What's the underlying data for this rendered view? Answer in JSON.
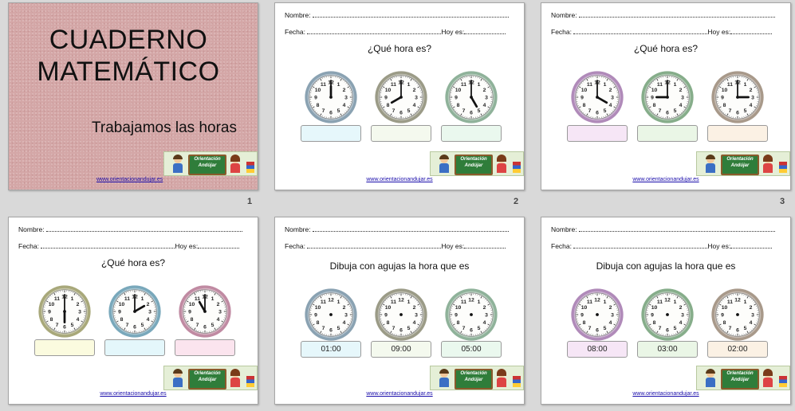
{
  "slide_numbers": [
    "1",
    "2",
    "3",
    "",
    "",
    ""
  ],
  "cover": {
    "title_line1": "CUADERNO",
    "title_line2": "MATEMÁTICO",
    "subtitle": "Trabajamos las horas"
  },
  "worksheet": {
    "name_label": "Nombre:",
    "date_label": "Fecha:",
    "today_label": "Hoy es:",
    "banner_text": "Orientación Andújar",
    "link": "www.orientacionandujar.es"
  },
  "slides": [
    {
      "title": "¿Qué hora es?",
      "clocks": [
        {
          "hour": 12,
          "minute": 0,
          "hands": true,
          "frame": "#8aa2b2",
          "box_color": "#e6f7fb",
          "box_label": ""
        },
        {
          "hour": 8,
          "minute": 0,
          "hands": true,
          "frame": "#9b9b87",
          "box_color": "#f4f9ee",
          "box_label": ""
        },
        {
          "hour": 5,
          "minute": 0,
          "hands": true,
          "frame": "#8fb29a",
          "box_color": "#eaf8ee",
          "box_label": ""
        }
      ]
    },
    {
      "title": "¿Qué hora es?",
      "clocks": [
        {
          "hour": 4,
          "minute": 0,
          "hands": true,
          "frame": "#b08ab9",
          "box_color": "#f6e6f6",
          "box_label": ""
        },
        {
          "hour": 9,
          "minute": 0,
          "hands": true,
          "frame": "#86ad8a",
          "box_color": "#eaf6e6",
          "box_label": ""
        },
        {
          "hour": 3,
          "minute": 0,
          "hands": true,
          "frame": "#a8998a",
          "box_color": "#fbf1e4",
          "box_label": ""
        }
      ]
    },
    {
      "title": "¿Qué hora es?",
      "clocks": [
        {
          "hour": 6,
          "minute": 0,
          "hands": true,
          "frame": "#a8a87a",
          "box_color": "#fbfbdf",
          "box_label": ""
        },
        {
          "hour": 2,
          "minute": 0,
          "hands": true,
          "frame": "#79a8bb",
          "box_color": "#e4f7fb",
          "box_label": ""
        },
        {
          "hour": 11,
          "minute": 0,
          "hands": true,
          "frame": "#c08aa2",
          "box_color": "#fbe4ee",
          "box_label": ""
        }
      ]
    },
    {
      "title": "Dibuja con agujas la hora que es",
      "clocks": [
        {
          "hands": false,
          "frame": "#8aa2b2",
          "box_color": "#e6f7fb",
          "box_label": "01:00"
        },
        {
          "hands": false,
          "frame": "#9b9b87",
          "box_color": "#f4f9ee",
          "box_label": "09:00"
        },
        {
          "hands": false,
          "frame": "#8fb29a",
          "box_color": "#eaf8ee",
          "box_label": "05:00"
        }
      ]
    },
    {
      "title": "Dibuja con agujas la hora que es",
      "clocks": [
        {
          "hands": false,
          "frame": "#b08ab9",
          "box_color": "#f6e6f6",
          "box_label": "08:00"
        },
        {
          "hands": false,
          "frame": "#86ad8a",
          "box_color": "#eaf6e6",
          "box_label": "03:00"
        },
        {
          "hands": false,
          "frame": "#a8998a",
          "box_color": "#fbf1e4",
          "box_label": "02:00"
        }
      ]
    }
  ]
}
